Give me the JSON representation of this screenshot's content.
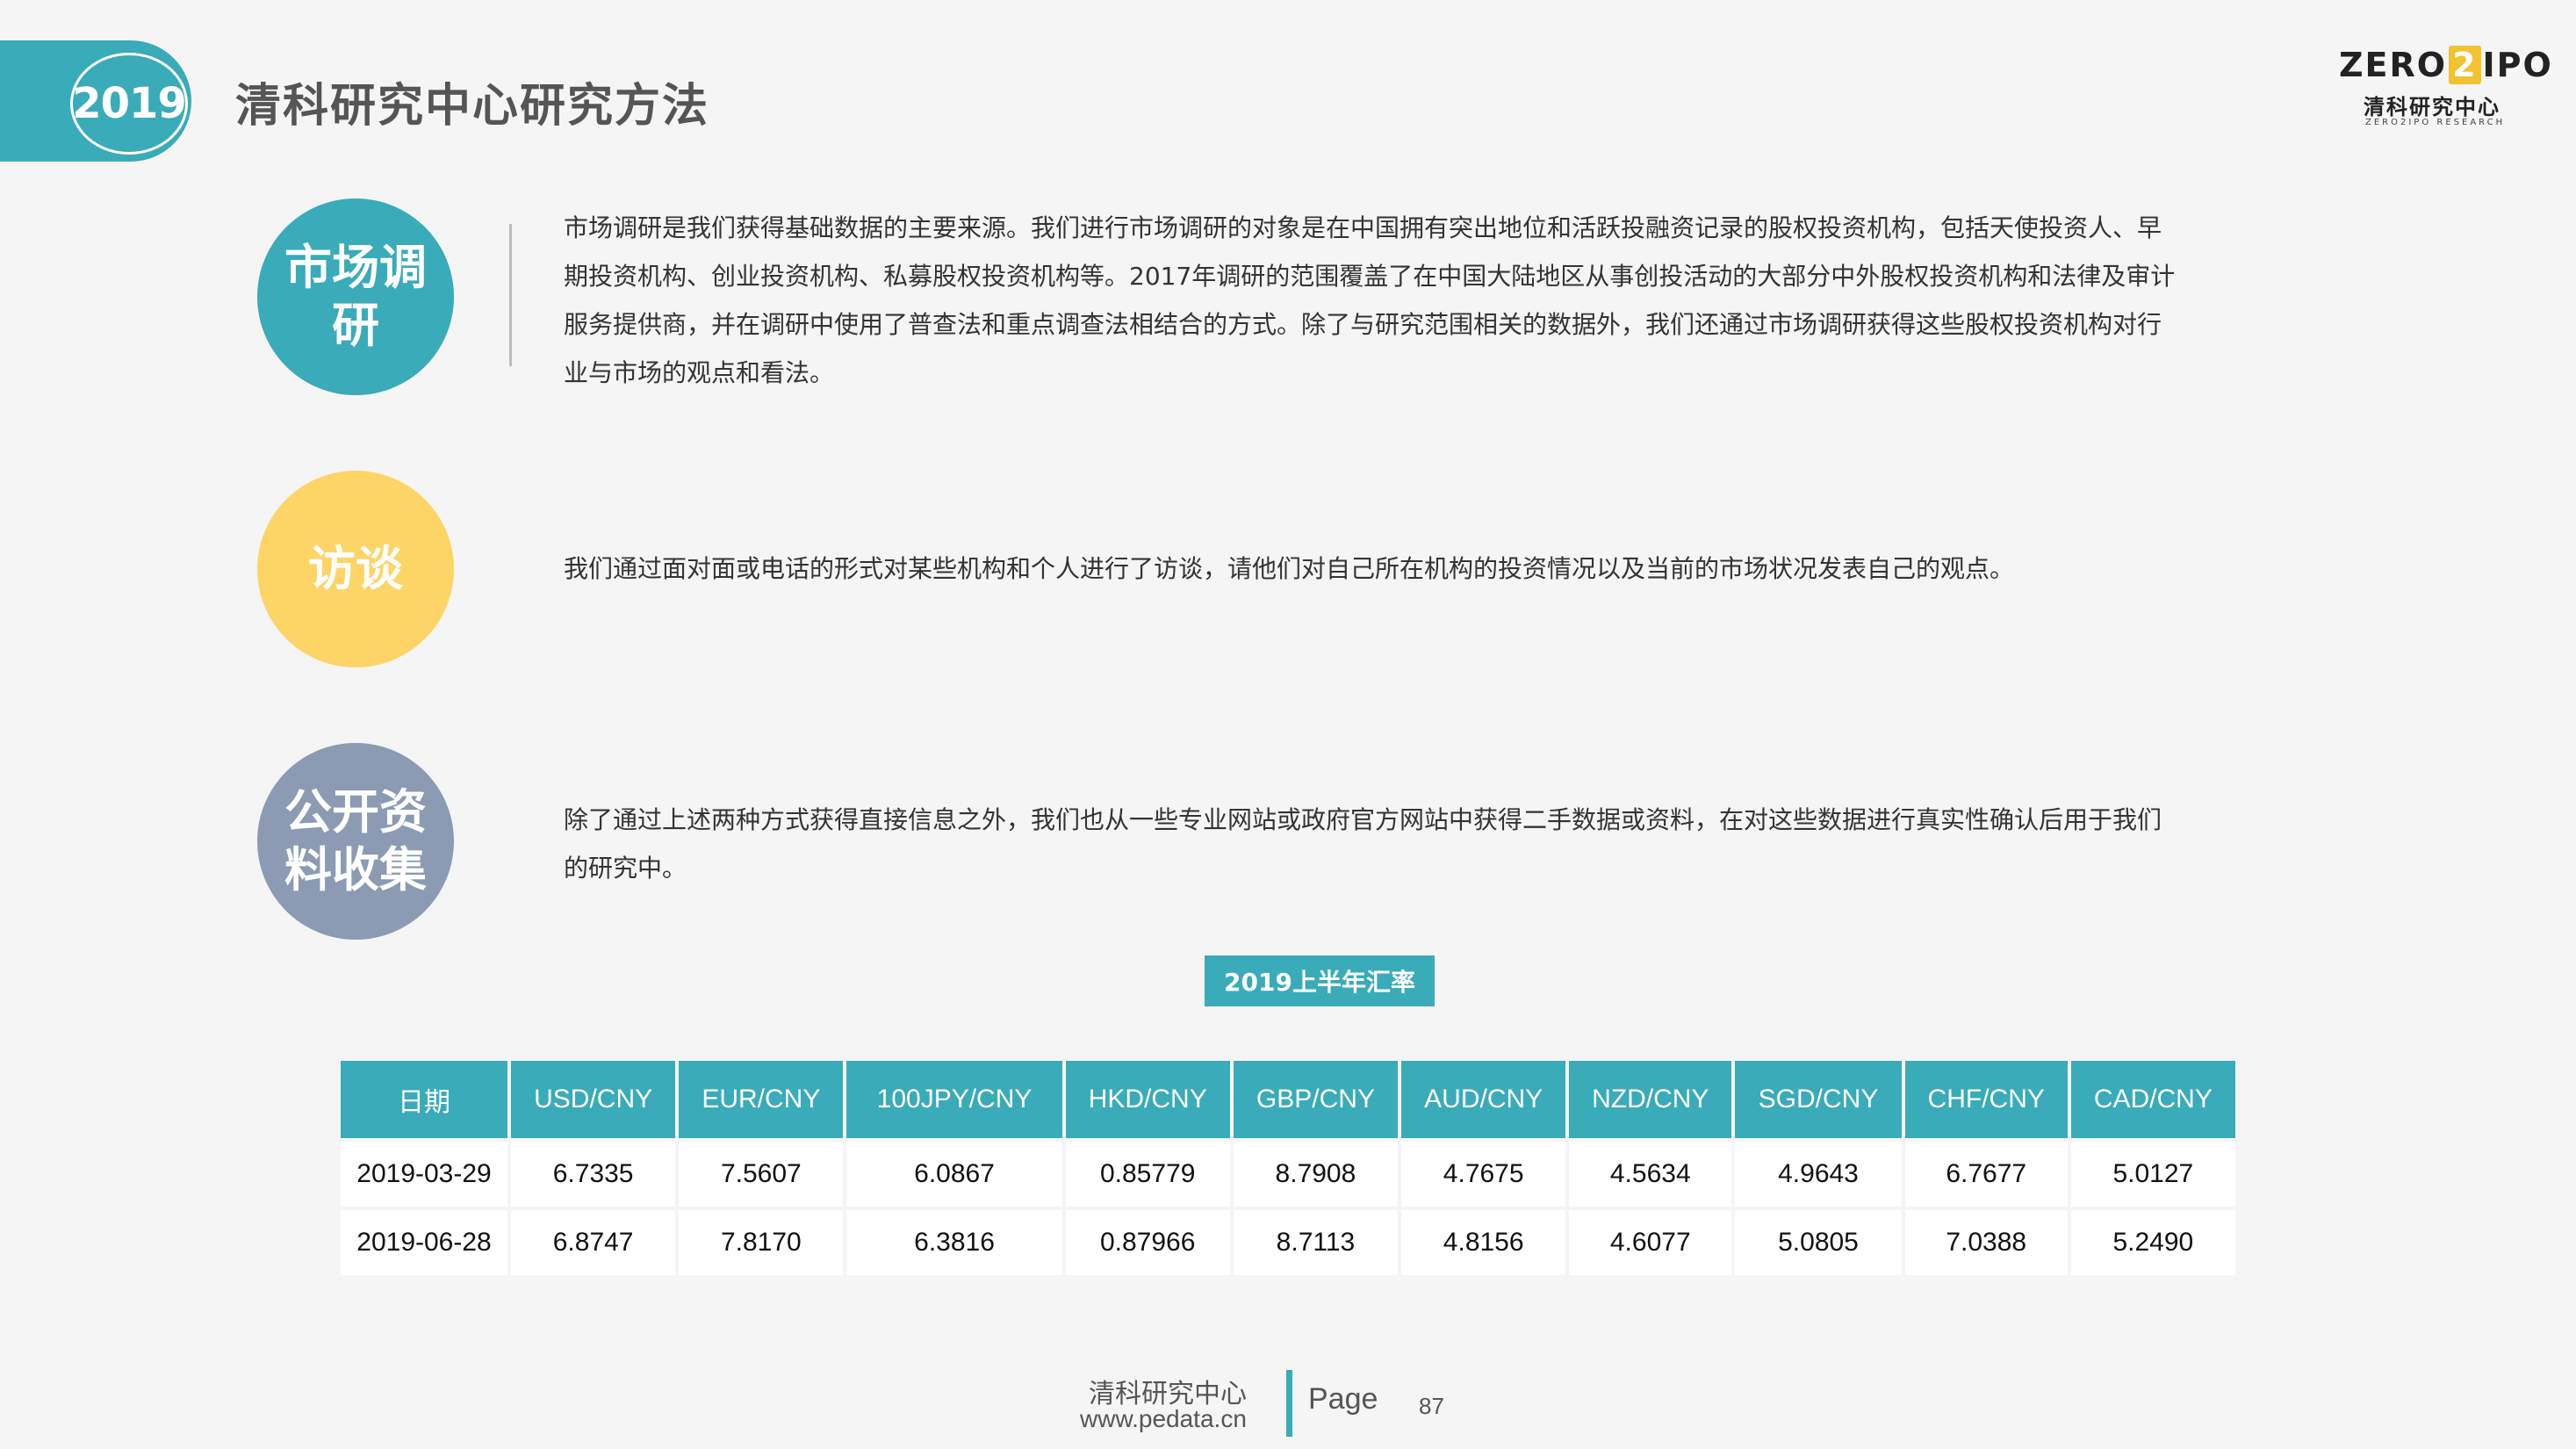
{
  "header": {
    "year": "2019",
    "title": "清科研究中心研究方法"
  },
  "logo": {
    "text_left": "ZERO",
    "text_digit": "2",
    "text_right": "IPO",
    "cn": "清科研究中心",
    "en": "ZERO2IPO RESEARCH"
  },
  "methods": [
    {
      "label": "市场调研",
      "text": "市场调研是我们获得基础数据的主要来源。我们进行市场调研的对象是在中国拥有突出地位和活跃投融资记录的股权投资机构，包括天使投资人、早期投资机构、创业投资机构、私募股权投资机构等。2017年调研的范围覆盖了在中国大陆地区从事创投活动的大部分中外股权投资机构和法律及审计服务提供商，并在调研中使用了普查法和重点调查法相结合的方式。除了与研究范围相关的数据外，我们还通过市场调研获得这些股权投资机构对行业与市场的观点和看法。"
    },
    {
      "label": "访谈",
      "text": "我们通过面对面或电话的形式对某些机构和个人进行了访谈，请他们对自己所在机构的投资情况以及当前的市场状况发表自己的观点。"
    },
    {
      "label": "公开资料收集",
      "text": "除了通过上述两种方式获得直接信息之外，我们也从一些专业网站或政府官方网站中获得二手数据或资料，在对这些数据进行真实性确认后用于我们的研究中。"
    }
  ],
  "rates_table": {
    "title": "2019上半年汇率",
    "headers": [
      "日期",
      "USD/CNY",
      "EUR/CNY",
      "100JPY/CNY",
      "HKD/CNY",
      "GBP/CNY",
      "AUD/CNY",
      "NZD/CNY",
      "SGD/CNY",
      "CHF/CNY",
      "CAD/CNY"
    ],
    "rows": [
      [
        "2019-03-29",
        "6.7335",
        "7.5607",
        "6.0867",
        "0.85779",
        "8.7908",
        "4.7675",
        "4.5634",
        "4.9643",
        "6.7677",
        "5.0127"
      ],
      [
        "2019-06-28",
        "6.8747",
        "7.8170",
        "6.3816",
        "0.87966",
        "8.7113",
        "4.8156",
        "4.6077",
        "5.0805",
        "7.0388",
        "5.2490"
      ]
    ]
  },
  "footer": {
    "org": "清科研究中心",
    "url": "www.pedata.cn",
    "page_label": "Page",
    "page_number": "87"
  },
  "colors": {
    "accent": "#3aabb8",
    "yellow": "#fdd567",
    "slate": "#8b9bb4",
    "background": "#f5f5f5"
  }
}
